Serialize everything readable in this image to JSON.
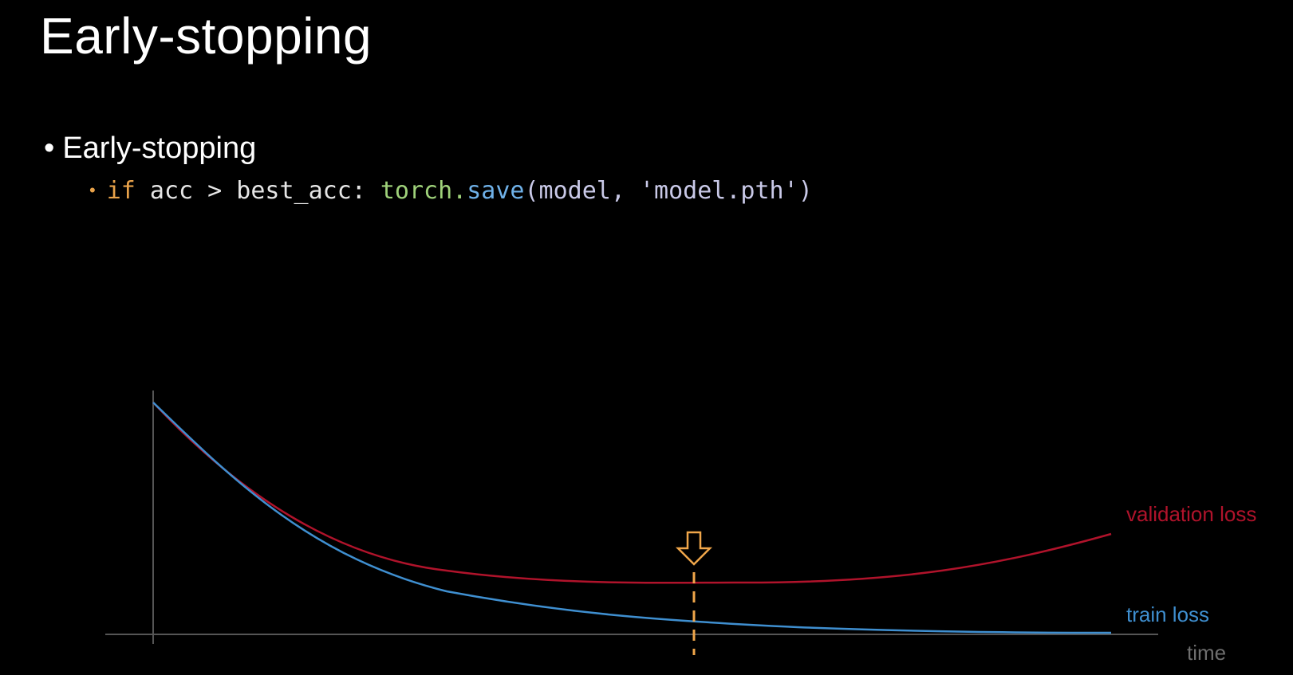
{
  "slide": {
    "title": "Early-stopping",
    "bullet": "Early-stopping",
    "code": {
      "kw_if": "if",
      "cond": " acc > best_acc: ",
      "module": "torch.",
      "func": "save",
      "args": "(model, ",
      "str": "'model.pth'",
      "close": ")"
    }
  },
  "diagram": {
    "labels": {
      "validation": "validation loss",
      "train": "train loss",
      "x_axis": "time"
    },
    "colors": {
      "validation": "#b0132b",
      "train": "#3f8fd0",
      "axis": "#555555",
      "marker": "#f0a64a",
      "x_label": "#6e6e6e"
    },
    "icons": {
      "marker": "down-arrow-outline"
    }
  }
}
